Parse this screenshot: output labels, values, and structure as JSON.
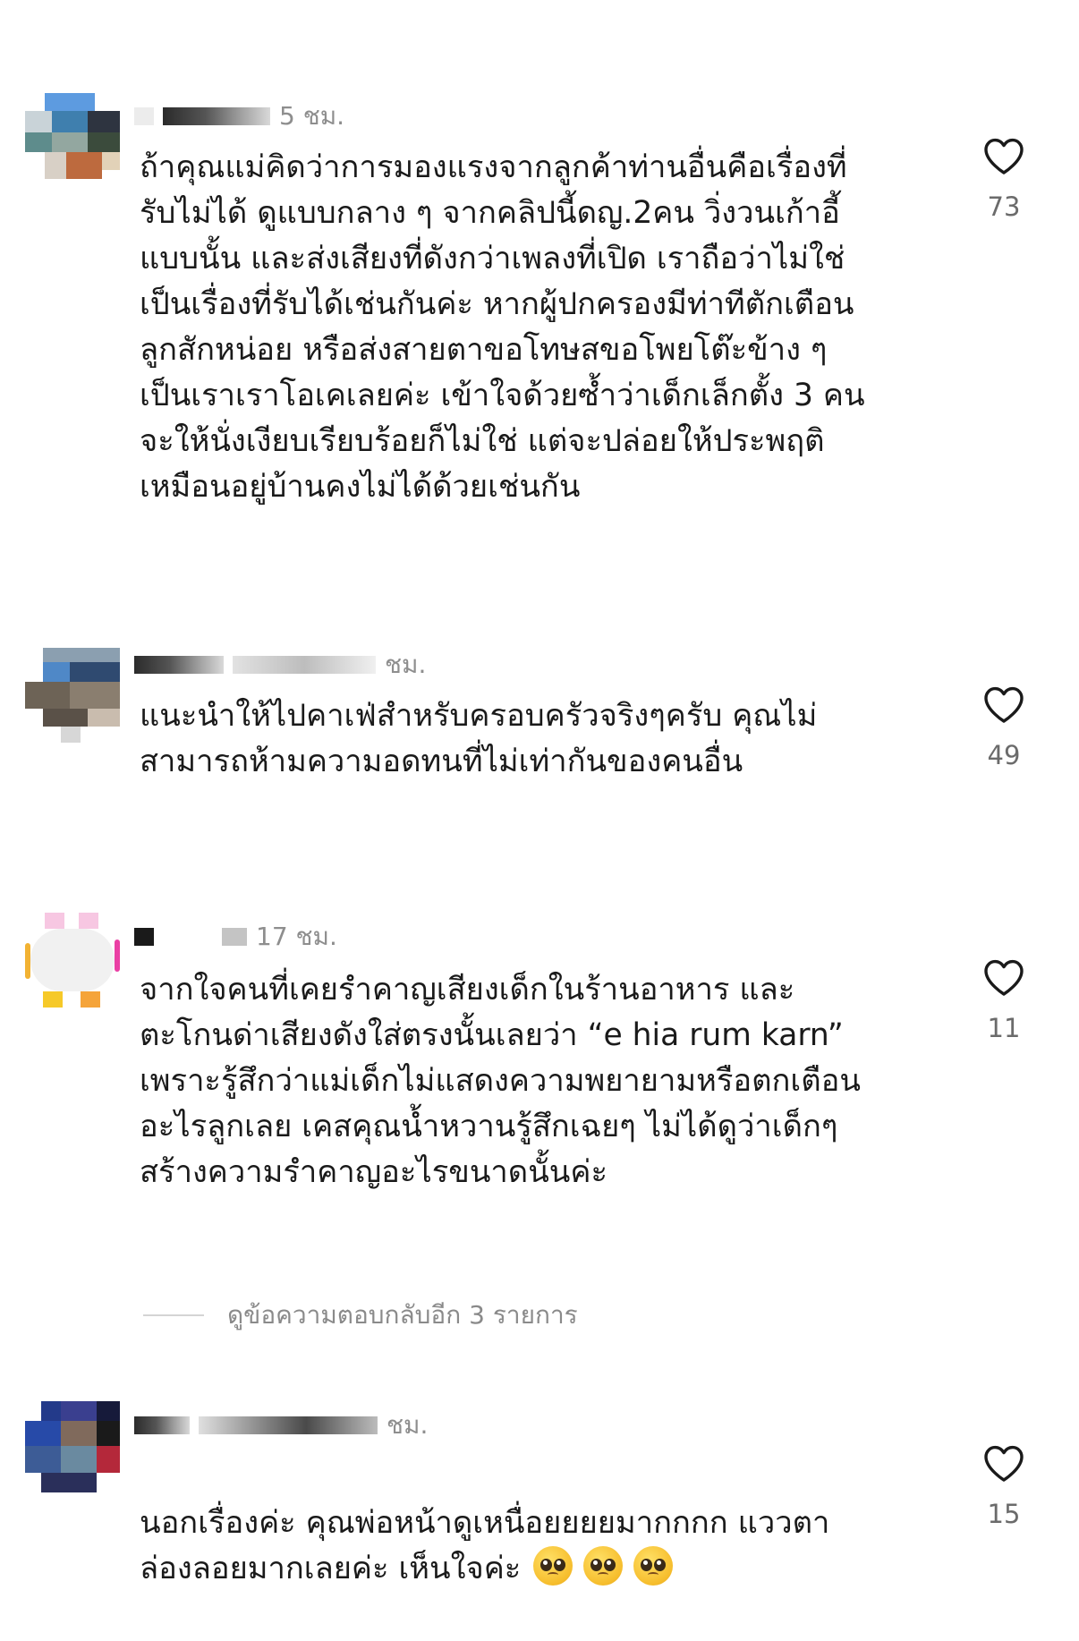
{
  "comments": [
    {
      "time": "5 ชม.",
      "text": "ถ้าคุณแม่คิดว่าการมองแรงจากลูกค้าท่านอื่นคือเรื่องที่\nรับไม่ได้ ดูแบบกลาง ๆ จากคลิปนี้ดญ.2คน วิ่งวนเก้าอี้\nแบบนั้น และส่งเสียงที่ดังกว่าเพลงที่เปิด เราถือว่าไม่ใช่\nเป็นเรื่องที่รับได้เช่นกันค่ะ หากผู้ปกครองมีท่าทีตักเตือน\nลูกสักหน่อย หรือส่งสายตาขอโทษสขอโพยโต๊ะข้าง ๆ\nเป็นเราเราโอเคเลยค่ะ เข้าใจด้วยซ้ำว่าเด็กเล็กตั้ง 3 คน\nจะให้นั่งเงียบเรียบร้อยก็ไม่ใช่ แต่จะปล่อยให้ประพฤติ\nเหมือนอยู่บ้านคงไม่ได้ด้วยเช่นกัน",
      "likes": "73"
    },
    {
      "time": "ชม.",
      "text": "แนะนำให้ไปคาเฟ่สำหรับครอบครัวจริงๆครับ คุณไม่\nสามารถห้ามความอดทนที่ไม่เท่ากันของคนอื่น",
      "likes": "49"
    },
    {
      "time": "17 ชม.",
      "text": "จากใจคนที่เคยรำคาญเสียงเด็กในร้านอาหาร และ\nตะโกนด่าเสียงดังใส่ตรงนั้นเลยว่า “e hia rum karn”\nเพราะรู้สึกว่าแม่เด็กไม่แสดงความพยายามหรือตกเตือน\nอะไรลูกเลย เคสคุณน้ำหวานรู้สึกเฉยๆ ไม่ได้ดูว่าเด็กๆ\nสร้างความรำคาญอะไรขนาดนั้นค่ะ",
      "likes": "11"
    },
    {
      "time": "ชม.",
      "text": "นอกเรื่องค่ะ คุณพ่อหน้าดูเหนื่อยยยยมากกกก แววตา\nล่องลอยมากเลยค่ะ เห็นใจค่ะ",
      "likes": "15"
    }
  ],
  "replies_link": "ดูข้อความตอบกลับอีก 3 รายการ",
  "icons": {
    "like": "heart-outline-icon",
    "emoji": "pleading-face-emoji"
  }
}
